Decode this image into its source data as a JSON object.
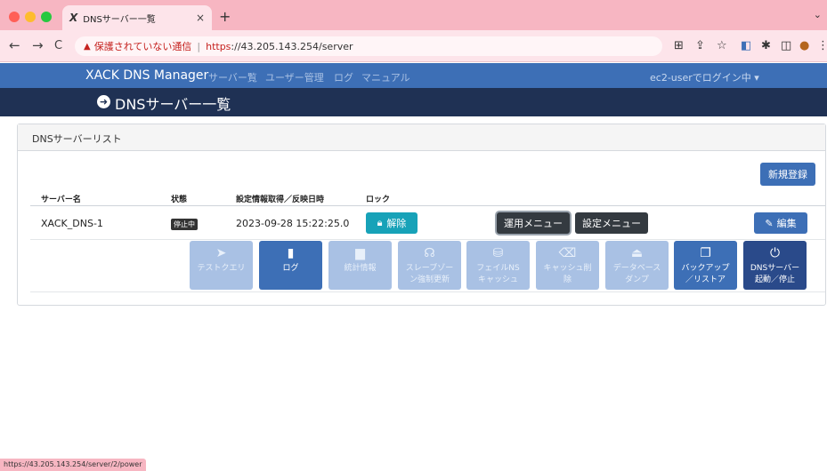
{
  "browser": {
    "tab_favicon": "X",
    "tab_title": "DNSサーバー一覧",
    "tab_close": "×",
    "new_tab": "+",
    "tab_menu": "⌄",
    "back": "←",
    "forward": "→",
    "reload": "C",
    "warning_text": "保護されていない通信",
    "url_scheme": "https",
    "url_rest": "://43.205.143.254/server",
    "status_url": "https://43.205.143.254/server/2/power"
  },
  "appbar": {
    "brand": "XACK DNS Manager",
    "nav_links": [
      "サーバー覧",
      "ユーザー管理",
      "ログ",
      "マニュアル"
    ],
    "user_menu": "ec2-userでログイン中 ▾"
  },
  "page": {
    "title": "DNSサーバー一覧"
  },
  "card": {
    "title": "DNSサーバーリスト",
    "new_button": "新規登録",
    "columns": [
      "サーバー名",
      "状態",
      "設定情報取得／反映日時",
      "ロック"
    ],
    "row": {
      "name": "XACK_DNS-1",
      "status": "停止中",
      "synced_at": "2023-09-28 15:22:25.0",
      "unlock_label": "解除",
      "ops_menu": "運用メニュー",
      "settings_menu": "設定メニュー",
      "edit_label": "編集"
    },
    "tiles": [
      {
        "line1": "テストクエリ",
        "line2": "",
        "icon": "paper-plane-icon",
        "state": "off"
      },
      {
        "line1": "ログ",
        "line2": "",
        "icon": "book-icon",
        "state": "on"
      },
      {
        "line1": "統計情報",
        "line2": "",
        "icon": "bar-chart-icon",
        "state": "off"
      },
      {
        "line1": "スレーブゾー",
        "line2": "ン強制更新",
        "icon": "headset-icon",
        "state": "off"
      },
      {
        "line1": "フェイルNS",
        "line2": "キャッシュ",
        "icon": "database-icon",
        "state": "off"
      },
      {
        "line1": "キャッシュ削",
        "line2": "除",
        "icon": "broom-icon",
        "state": "off"
      },
      {
        "line1": "データベース",
        "line2": "ダンプ",
        "icon": "dump-icon",
        "state": "off"
      },
      {
        "line1": "バックアップ",
        "line2": "／リストア",
        "icon": "copy-icon",
        "state": "on"
      },
      {
        "line1": "DNSサーバー",
        "line2": "起動／停止",
        "icon": "power-icon",
        "state": "dark"
      }
    ]
  }
}
